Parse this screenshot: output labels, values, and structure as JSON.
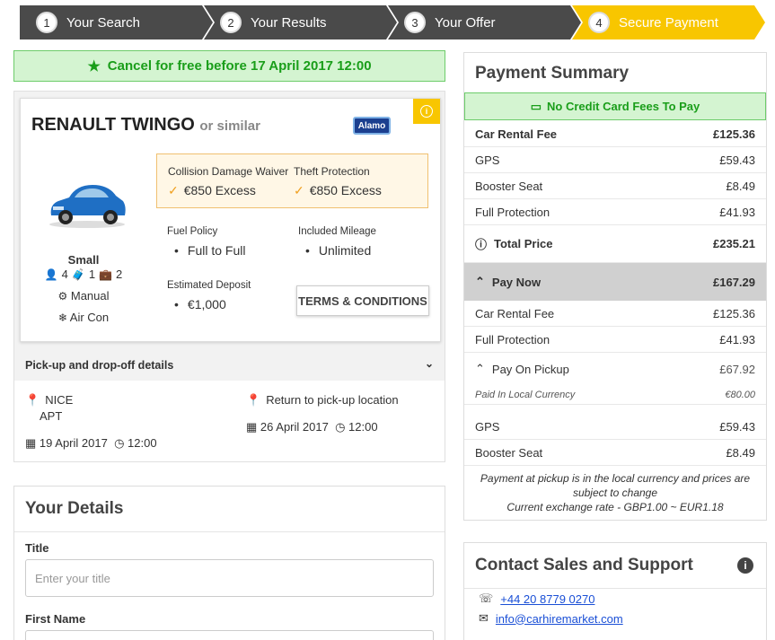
{
  "steps": [
    {
      "number": "1",
      "label": "Your Search"
    },
    {
      "number": "2",
      "label": "Your Results"
    },
    {
      "number": "3",
      "label": "Your Offer"
    },
    {
      "number": "4",
      "label": "Secure Payment"
    }
  ],
  "colors": {
    "step_dark": "#4a4a4a",
    "step_active": "#f8c600",
    "green": "#1a9e1a",
    "green_bg": "#d4f4d1"
  },
  "cancel_banner": "Cancel for free before 17 April 2017 12:00",
  "car": {
    "name": "RENAULT TWINGO",
    "similar": "or similar",
    "supplier": "Alamo",
    "size": "Small",
    "passengers": "4",
    "large_bags": "1",
    "small_bags": "2",
    "transmission": "Manual",
    "aircon": "Air Con"
  },
  "cover": {
    "cdw_label": "Collision Damage Waiver",
    "cdw_value": "€850 Excess",
    "theft_label": "Theft Protection",
    "theft_value": "€850 Excess"
  },
  "features": {
    "fuel_label": "Fuel Policy",
    "fuel_value": "Full to Full",
    "mileage_label": "Included Mileage",
    "mileage_value": "Unlimited",
    "deposit_label": "Estimated Deposit",
    "deposit_value": "€1,000"
  },
  "terms_button": "TERMS & CONDITIONS",
  "pickup": {
    "header": "Pick-up and drop-off details",
    "pick_location_line1": "NICE",
    "pick_location_line2": "APT",
    "pick_date": "19 April 2017",
    "pick_time": "12:00",
    "drop_location": "Return to pick-up location",
    "drop_date": "26 April 2017",
    "drop_time": "12:00"
  },
  "details": {
    "title": "Your Details",
    "title_label": "Title",
    "title_placeholder": "Enter your title",
    "first_name_label": "First Name"
  },
  "summary": {
    "title": "Payment Summary",
    "no_fees": "No Credit Card Fees To Pay",
    "rows": [
      {
        "label": "Car Rental Fee",
        "amount": "£125.36"
      },
      {
        "label": "GPS",
        "amount": "£59.43"
      },
      {
        "label": "Booster Seat",
        "amount": "£8.49"
      },
      {
        "label": "Full Protection",
        "amount": "£41.93"
      }
    ],
    "total_label": "Total Price",
    "total_amount": "£235.21",
    "pay_now_label": "Pay Now",
    "pay_now_amount": "£167.29",
    "pay_now_rows": [
      {
        "label": "Car Rental Fee",
        "amount": "£125.36"
      },
      {
        "label": "Full Protection",
        "amount": "£41.93"
      }
    ],
    "pay_pickup_label": "Pay On Pickup",
    "pay_pickup_amount": "£67.92",
    "local_label": "Paid In Local Currency",
    "local_amount": "€80.00",
    "pickup_rows": [
      {
        "label": "GPS",
        "amount": "£59.43"
      },
      {
        "label": "Booster Seat",
        "amount": "£8.49"
      }
    ],
    "note_line1": "Payment at pickup is in the local currency and prices are",
    "note_line2": "subject to change",
    "note_line3": "Current exchange rate - GBP1.00 ~ EUR1.18"
  },
  "contact": {
    "title": "Contact Sales and Support",
    "phone": "+44 20 8779 0270",
    "email": "info@carhiremarket.com"
  }
}
